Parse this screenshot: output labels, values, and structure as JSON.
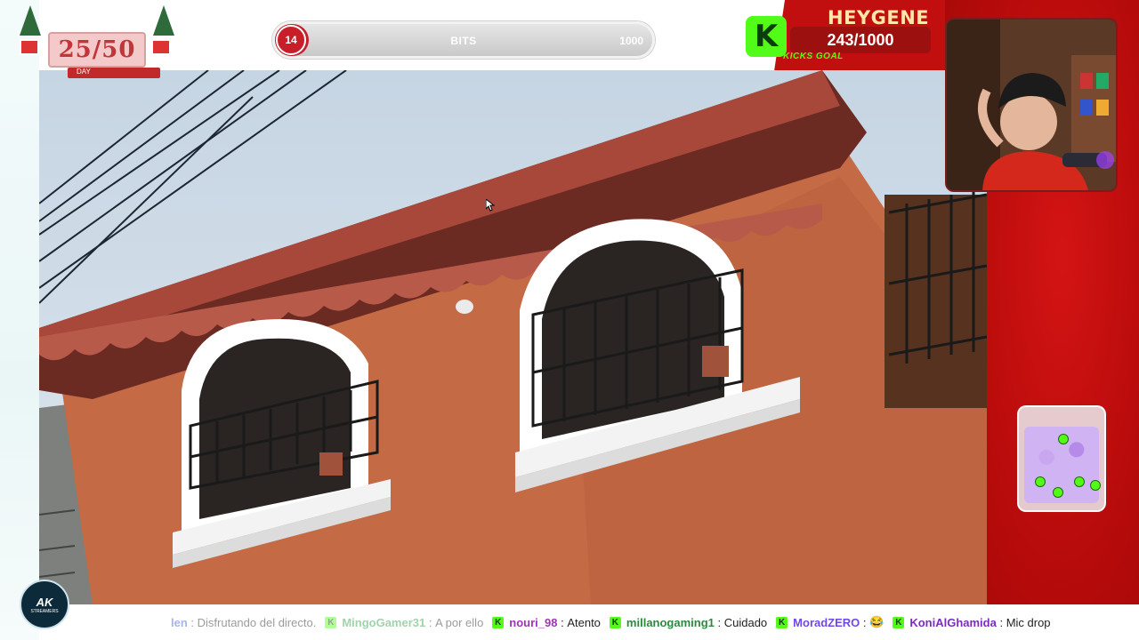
{
  "advent": {
    "count": "25/50",
    "caption": "DAY"
  },
  "bits": {
    "current": "14",
    "label": "BITS",
    "max": "1000",
    "progress": 0.014
  },
  "kicks_goal": {
    "name": "HEYGENE",
    "count": "243/1000",
    "tag": "KICKS GOAL",
    "logo": "K",
    "progress": 0.243
  },
  "logo": {
    "main": "AK",
    "sub": "STREAMERS"
  },
  "chat": [
    {
      "user": "len",
      "text": "Disfrutando del directo.",
      "color": "#3b5bdb",
      "badge": false,
      "faded": true
    },
    {
      "user": "MingoGamer31",
      "text": "A por ello",
      "color": "#2f9e44",
      "badge": true,
      "faded": true
    },
    {
      "user": "nouri_98",
      "text": "Atento",
      "color": "#9c36b5",
      "badge": true,
      "faded": false
    },
    {
      "user": "millanogaming1",
      "text": "Cuidado",
      "color": "#2b8a3e",
      "badge": true,
      "faded": false
    },
    {
      "user": "MoradZERO",
      "text": "😂",
      "color": "#7048e8",
      "badge": true,
      "faded": false
    },
    {
      "user": "KoniAlGhamida",
      "text": "Mic drop",
      "color": "#7b2cbf",
      "badge": true,
      "faded": false
    }
  ],
  "colors": {
    "brand_red": "#c10f0f",
    "kick_green": "#53fc18"
  },
  "icons": [
    "christmas-tree-icon",
    "gift-icon",
    "kick-logo-icon",
    "ak-streamers-logo",
    "kick-badge-icon",
    "mouse-cursor-icon"
  ]
}
